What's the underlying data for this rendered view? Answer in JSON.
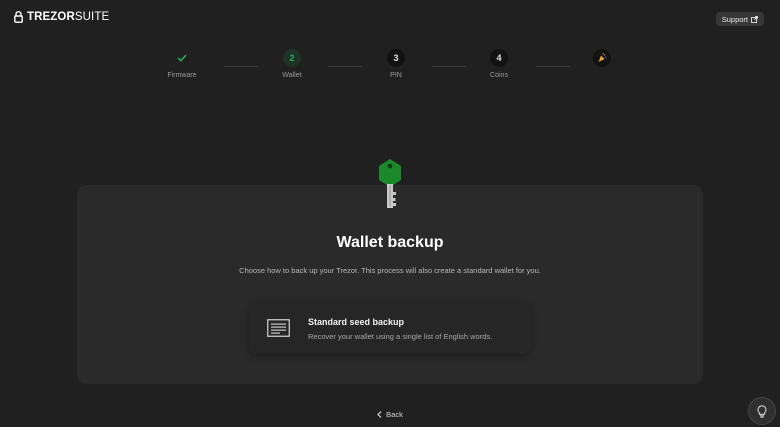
{
  "header": {
    "logo_bold": "TREZOR",
    "logo_light": "SUITE",
    "support_label": "Support"
  },
  "stepper": {
    "steps": [
      {
        "label": "Firmware",
        "state": "done",
        "number": ""
      },
      {
        "label": "Wallet",
        "state": "current",
        "number": "2"
      },
      {
        "label": "PIN",
        "state": "todo",
        "number": "3"
      },
      {
        "label": "Coins",
        "state": "todo",
        "number": "4"
      },
      {
        "label": "",
        "state": "final",
        "number": ""
      }
    ],
    "colors": {
      "done": "#2fa856",
      "todo_bg": "#121212"
    }
  },
  "main": {
    "title": "Wallet backup",
    "subtitle": "Choose how to back up your Trezor. This process will also create a standard wallet for you.",
    "option": {
      "title": "Standard seed backup",
      "description": "Recover your wallet using a single list of English words.",
      "icon": "document-lines-icon"
    },
    "illustration": "key-icon",
    "accent": "#1c8a2c"
  },
  "footer": {
    "back_label": "Back",
    "tips_icon": "lightbulb-icon"
  }
}
